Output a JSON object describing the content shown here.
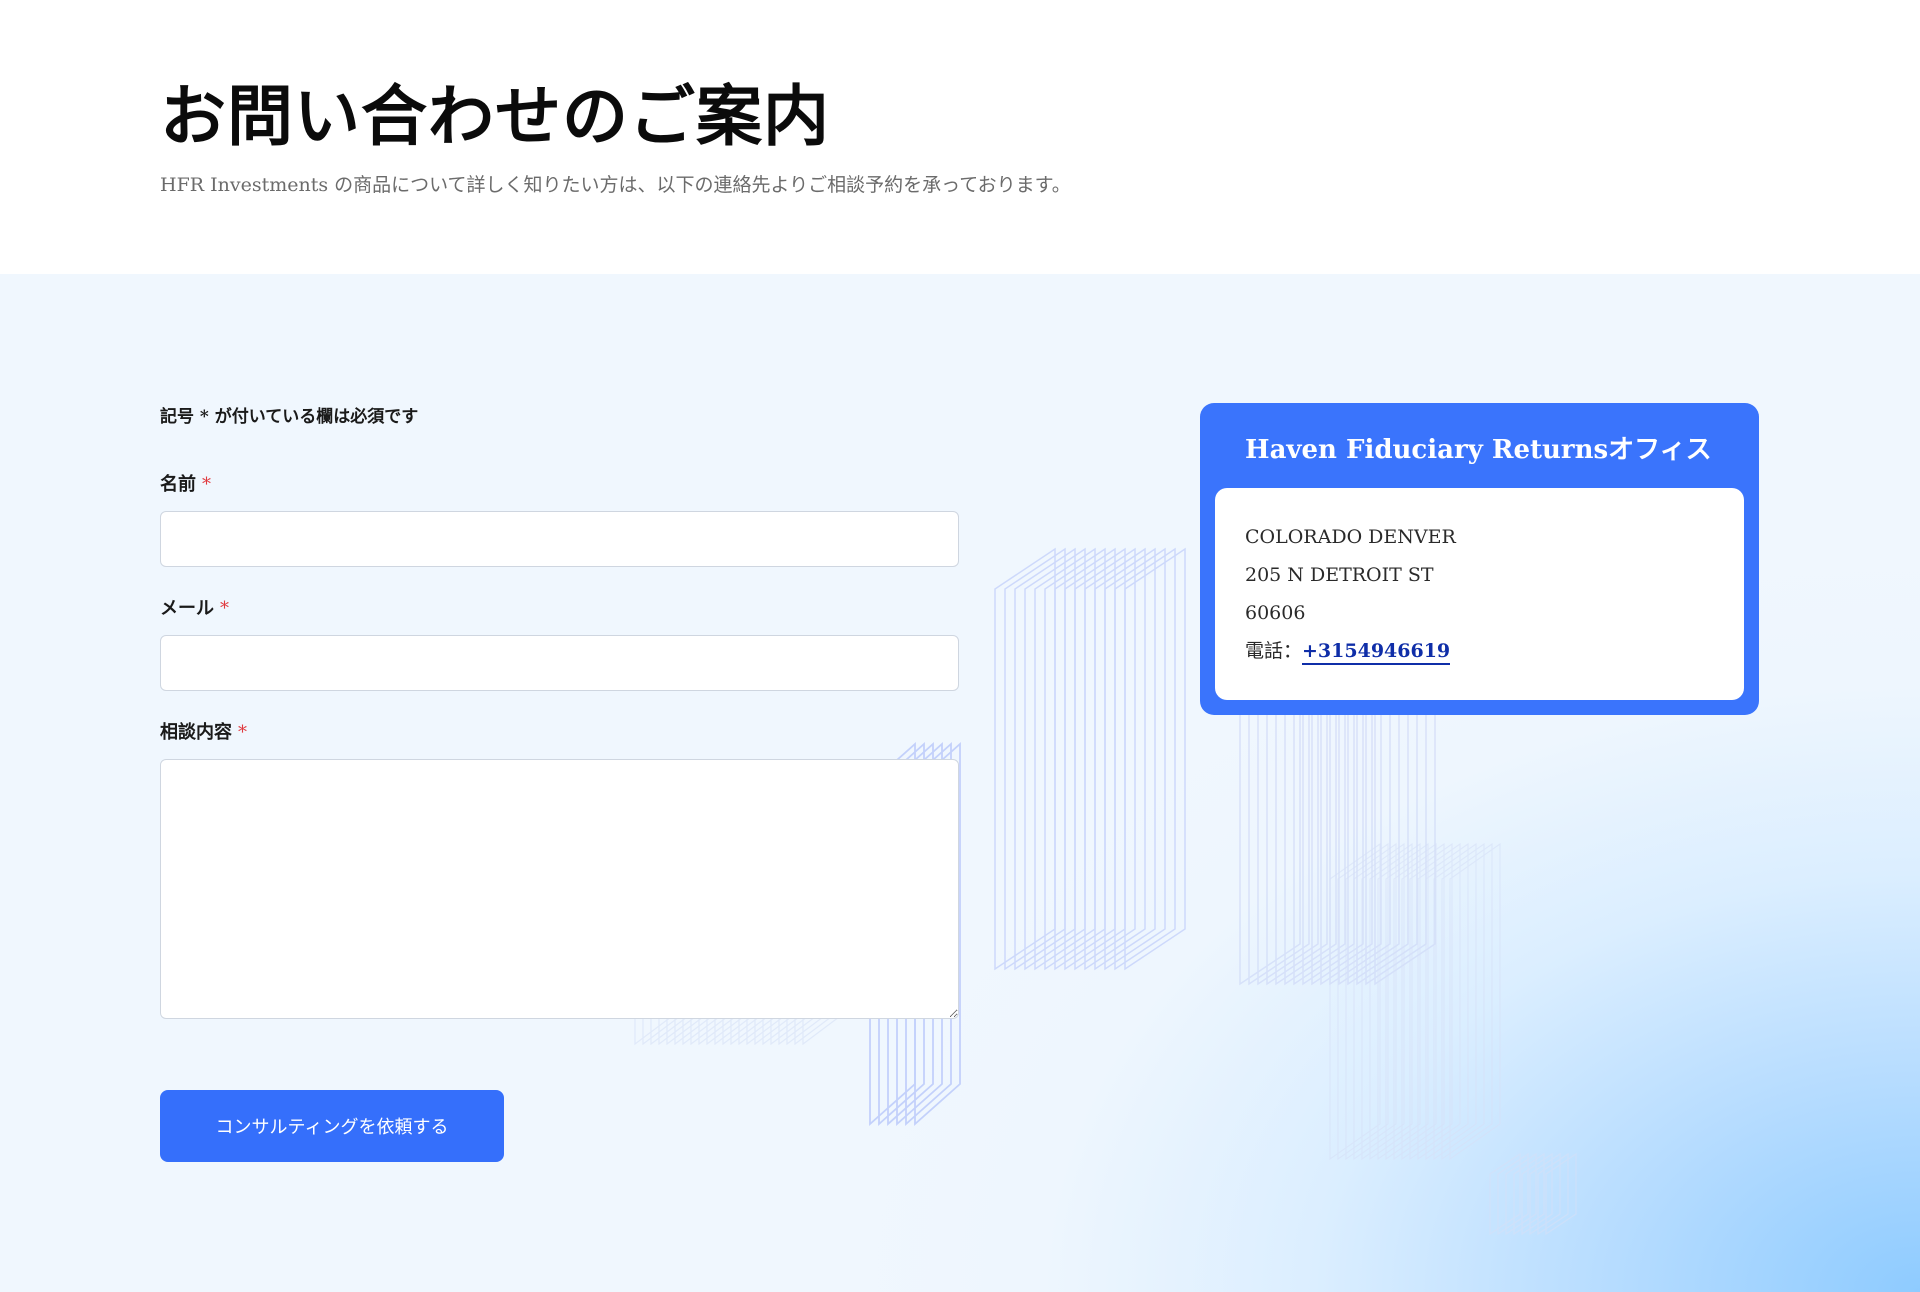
{
  "hero": {
    "title": "お問い合わせのご案内",
    "subtitle": "HFR Investments の商品について詳しく知りたい方は、以下の連絡先よりご相談予約を承っております。"
  },
  "form": {
    "required_note": "記号 * が付いている欄は必須です",
    "required_mark": "*",
    "name_label": "名前",
    "email_label": "メール",
    "message_label": "相談内容",
    "name_value": "",
    "email_value": "",
    "message_value": "",
    "submit_label": "コンサルティングを依頼する"
  },
  "office": {
    "title": "Haven Fiduciary Returnsオフィス",
    "address_line1": "COLORADO DENVER",
    "address_line2": "205 N DETROIT ST",
    "postal_code": "60606",
    "phone_label": "電話：",
    "phone_number": "+3154946619"
  },
  "colors": {
    "accent": "#356ffb",
    "card": "#3a74fc",
    "required": "#e0393e",
    "link": "#0f2ea8",
    "section_bg": "#f0f7fe"
  }
}
